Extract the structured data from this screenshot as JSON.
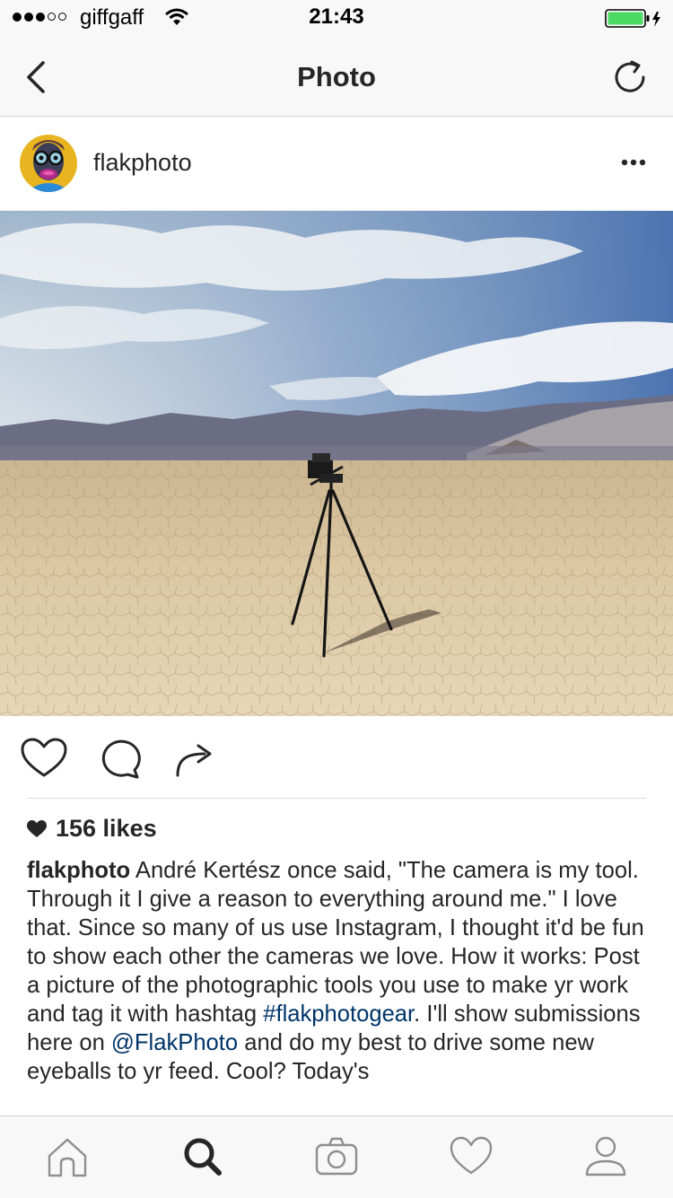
{
  "status_bar": {
    "carrier": "giffgaff",
    "time": "21:43",
    "signal_bars_filled": 3,
    "signal_bars_total": 5,
    "battery_color": "#4cd964"
  },
  "nav": {
    "title": "Photo",
    "back_icon": "chevron-left-icon",
    "refresh_icon": "refresh-icon"
  },
  "post": {
    "username": "flakphoto",
    "more_icon": "ellipsis-icon",
    "likes": "156 likes",
    "caption": {
      "user": "flakphoto",
      "text_1": " André Kertész once said, \"The camera is my tool. Through it I give a reason to everything around me.\" I love that. Since so many of us use Instagram, I thought it'd be fun to show each other the cameras we love. How it works: Post a picture of the photographic tools you use to make yr work and tag it with hashtag ",
      "hashtag": "#flakphotogear",
      "text_2": ". I'll show submissions here on ",
      "mention": "@FlakPhoto",
      "text_3": " and do my best to drive some new eyeballs to yr feed. Cool? Today's"
    }
  },
  "tab_bar": {
    "items": [
      "home-icon",
      "search-icon",
      "camera-icon",
      "heart-icon",
      "profile-icon"
    ],
    "active": "search-icon"
  },
  "colors": {
    "link": "#003569",
    "text": "#262626",
    "bar_background": "#f8f8f8"
  }
}
